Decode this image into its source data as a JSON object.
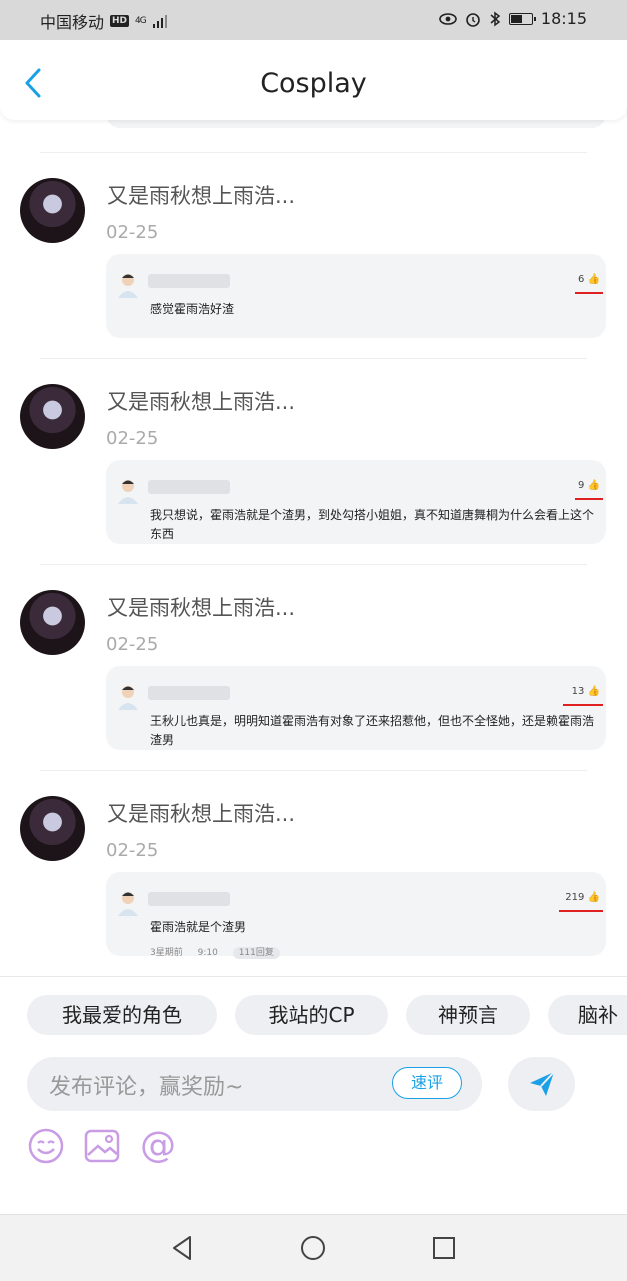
{
  "status_bar": {
    "carrier": "中国移动",
    "hd": "HD",
    "network": "4G",
    "time": "18:15",
    "battery_level": 0.6
  },
  "header": {
    "title": "Cosplay"
  },
  "feed": {
    "items": [
      {
        "title": "又是雨秋想上雨浩...",
        "date": "02-25",
        "comment": {
          "text": "感觉霍雨浩好渣",
          "likes": "6",
          "meta": []
        }
      },
      {
        "title": "又是雨秋想上雨浩...",
        "date": "02-25",
        "comment": {
          "text": "我只想说，霍雨浩就是个渣男，到处勾搭小姐姐，真不知道唐舞桐为什么会看上这个东西",
          "likes": "9",
          "meta": []
        }
      },
      {
        "title": "又是雨秋想上雨浩...",
        "date": "02-25",
        "comment": {
          "text": "王秋儿也真是，明明知道霍雨浩有对象了还来招惹他，但也不全怪她，还是赖霍雨浩渣男",
          "likes": "13",
          "meta": []
        }
      },
      {
        "title": "又是雨秋想上雨浩...",
        "date": "02-25",
        "comment": {
          "text": "霍雨浩就是个渣男",
          "likes": "219",
          "meta": [
            "3星期前",
            "9:10",
            "111回复"
          ]
        }
      }
    ]
  },
  "bottom": {
    "tags": [
      "我最爱的角色",
      "我站的CP",
      "神预言",
      "脑补"
    ],
    "input_placeholder": "发布评论，赢奖励~",
    "quick_review": "速评"
  },
  "colors": {
    "accent": "#1aa0e6",
    "like_underline": "#e02020",
    "tool_icon": "#c99ce6"
  }
}
